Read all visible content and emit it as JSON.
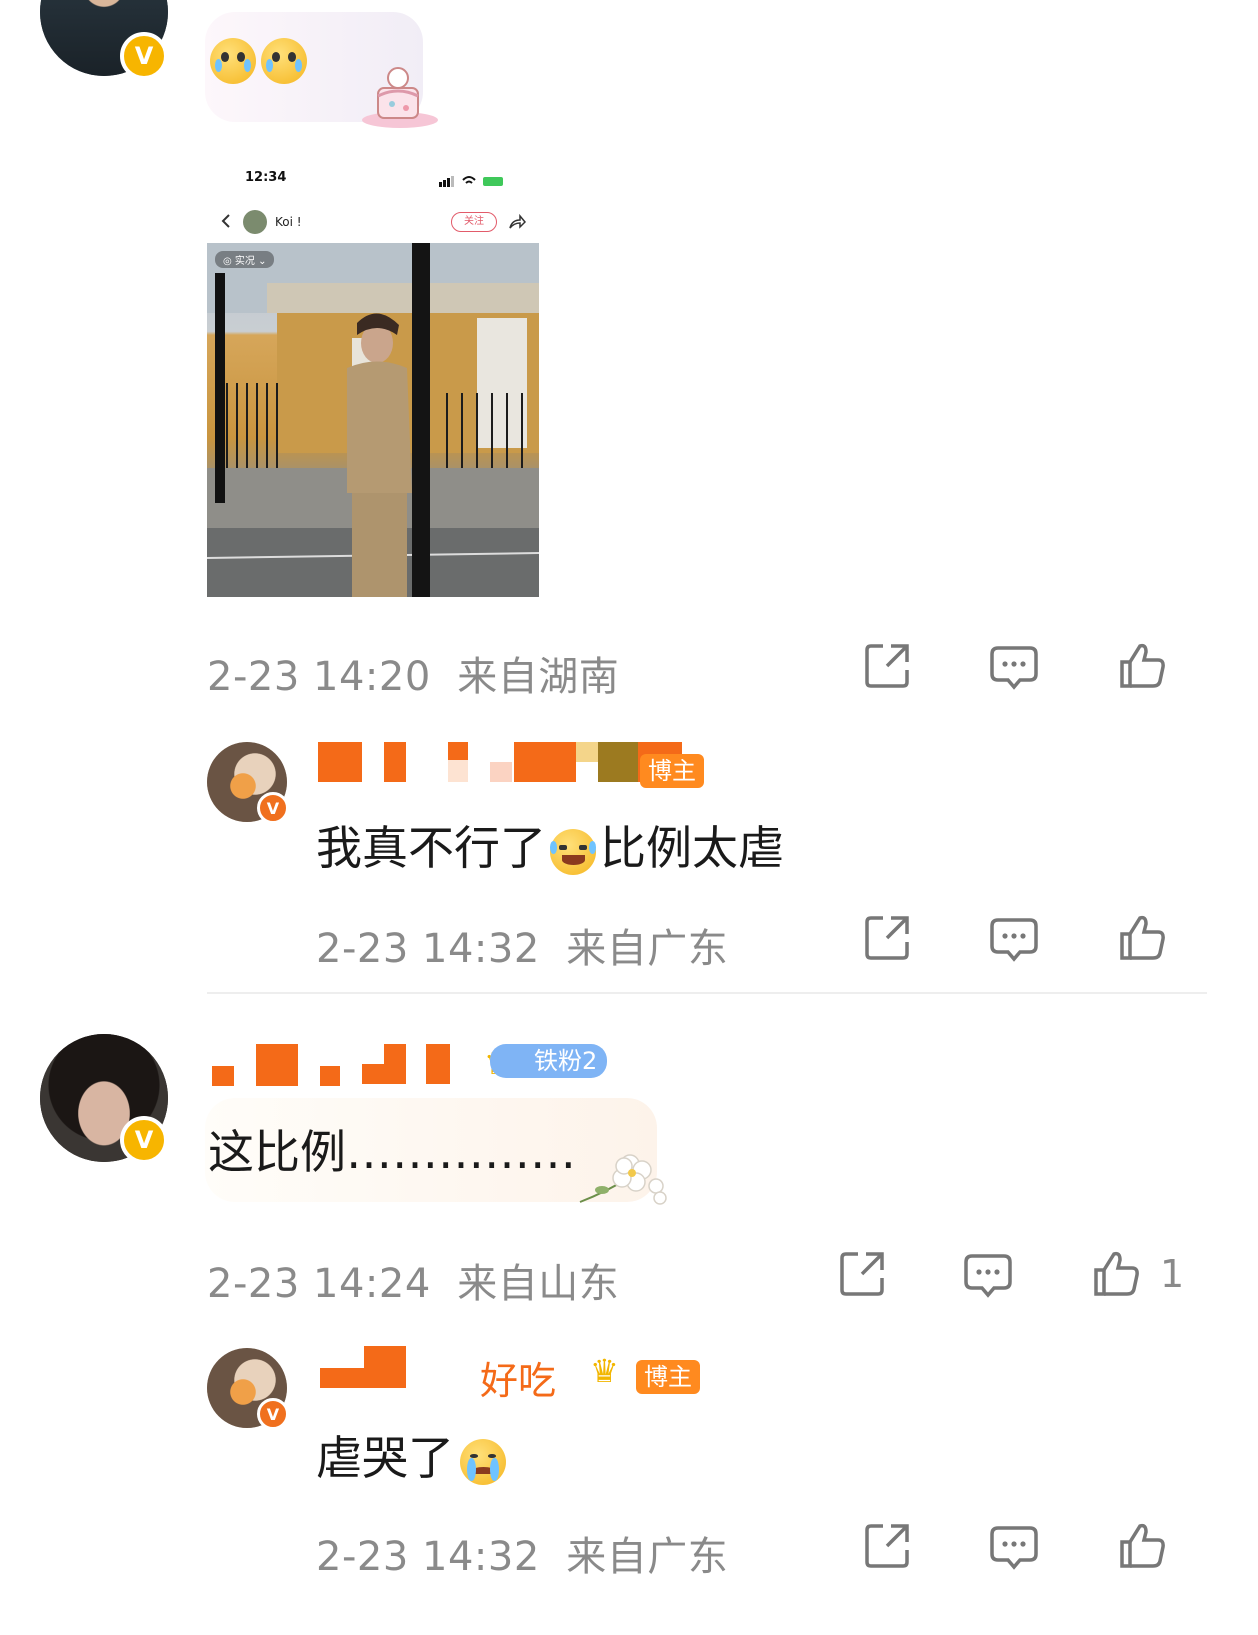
{
  "comments": [
    {
      "id": "c1",
      "timestamp": "2-23 14:20",
      "location": "来自湖南",
      "sticker_emojis": [
        "face-holding-back-tears",
        "face-holding-back-tears"
      ],
      "image_preview": {
        "status_time": "12:34",
        "author_name": "Koi !",
        "follow_label": "关注",
        "live_tag": "实况"
      }
    },
    {
      "id": "r1",
      "badge": "博主",
      "text_before": "我真不行了",
      "text_after": "比例太虐",
      "emoji": "laughing-crying-face",
      "timestamp": "2-23 14:32",
      "location": "来自广东"
    },
    {
      "id": "c2",
      "fan_badge": "铁粉2",
      "text": "这比例……………",
      "timestamp": "2-23 14:24",
      "location": "来自山东",
      "like_count": "1"
    },
    {
      "id": "r2",
      "name_visible": "好吃",
      "badge": "博主",
      "text": "虐哭了",
      "emoji": "crying-face",
      "timestamp": "2-23 14:32",
      "location": "来自广东"
    }
  ],
  "colors": {
    "meta_gray": "#8a8a8a",
    "blogger_badge": "#ff8a1f",
    "fan_badge": "#7fb4f5",
    "verified_gold": "#f7b500",
    "verified_orange": "#f0701e"
  }
}
